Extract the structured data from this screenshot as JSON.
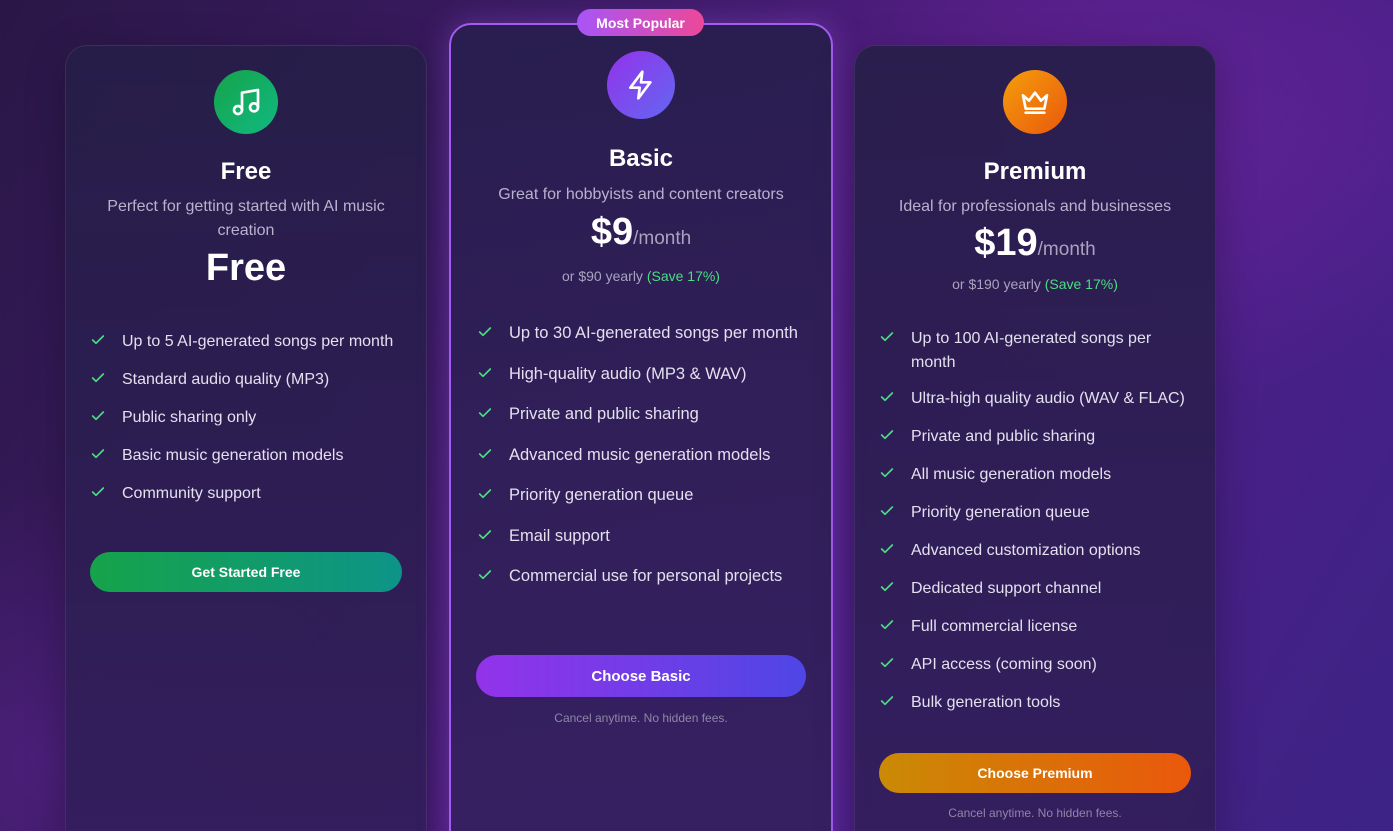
{
  "badge": "Most Popular",
  "plans": {
    "free": {
      "icon": "music-note-icon",
      "name": "Free",
      "description": "Perfect for getting started with AI music creation",
      "price": "Free",
      "features": [
        "Up to 5 AI-generated songs per month",
        "Standard audio quality (MP3)",
        "Public sharing only",
        "Basic music generation models",
        "Community support"
      ],
      "cta": "Get Started Free"
    },
    "basic": {
      "icon": "lightning-bolt-icon",
      "name": "Basic",
      "description": "Great for hobbyists and content creators",
      "price": "$9",
      "period": "/month",
      "yearly": "or $90 yearly",
      "save": "(Save 17%)",
      "features": [
        "Up to 30 AI-generated songs per month",
        "High-quality audio (MP3 & WAV)",
        "Private and public sharing",
        "Advanced music generation models",
        "Priority generation queue",
        "Email support",
        "Commercial use for personal projects"
      ],
      "cta": "Choose Basic",
      "fine_print": "Cancel anytime. No hidden fees."
    },
    "premium": {
      "icon": "crown-icon",
      "name": "Premium",
      "description": "Ideal for professionals and businesses",
      "price": "$19",
      "period": "/month",
      "yearly": "or $190 yearly",
      "save": "(Save 17%)",
      "features": [
        "Up to 100 AI-generated songs per month",
        "Ultra-high quality audio (WAV & FLAC)",
        "Private and public sharing",
        "All music generation models",
        "Priority generation queue",
        "Advanced customization options",
        "Dedicated support channel",
        "Full commercial license",
        "API access (coming soon)",
        "Bulk generation tools"
      ],
      "cta": "Choose Premium",
      "fine_print": "Cancel anytime. No hidden fees."
    }
  },
  "colors": {
    "check": "#4ade80",
    "free_accent": "#16a34a",
    "basic_accent": "#9333ea",
    "premium_accent": "#ea580c",
    "popular_border": "#a35cf0"
  }
}
